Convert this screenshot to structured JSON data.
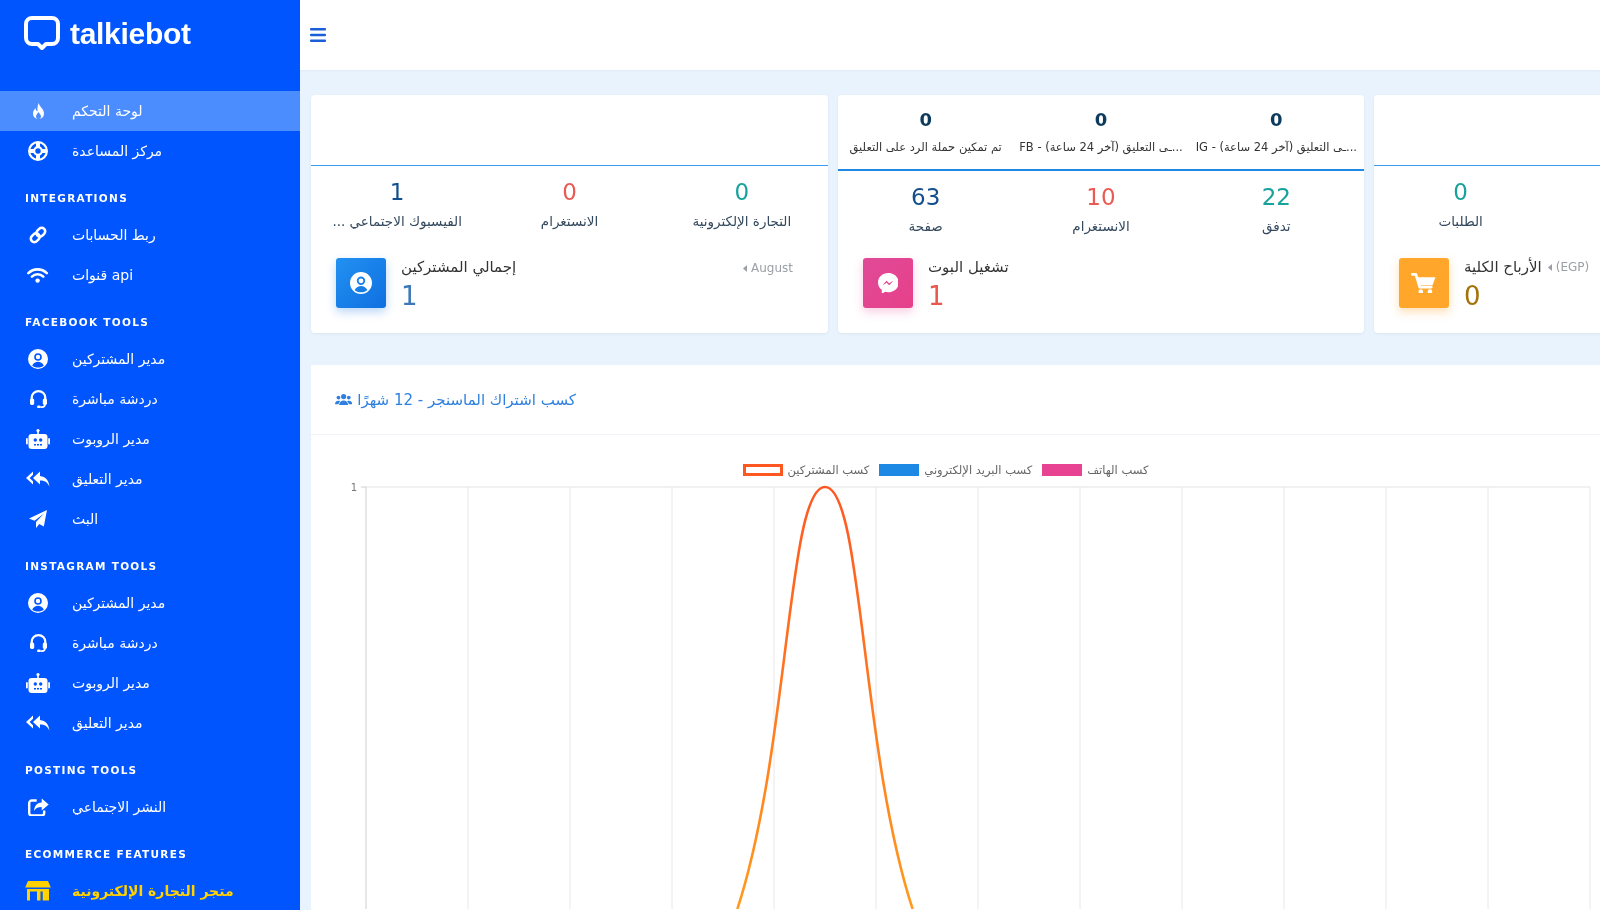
{
  "sidebar": {
    "logo_text": "talkiebot",
    "sections": [
      {
        "items": [
          {
            "label": "لوحة التحكم",
            "selected": true,
            "highlighted": false
          },
          {
            "label": "مركز المساعدة",
            "selected": false,
            "highlighted": false
          }
        ]
      },
      {
        "heading": "INTEGRATIONS",
        "items": [
          {
            "label": "ربط الحسابات",
            "selected": false,
            "highlighted": false
          },
          {
            "label": "قنوات api",
            "selected": false,
            "highlighted": false
          }
        ]
      },
      {
        "heading": "FACEBOOK TOOLS",
        "items": [
          {
            "label": "مدير المشتركين",
            "selected": false,
            "highlighted": false
          },
          {
            "label": "دردشة مباشرة",
            "selected": false,
            "highlighted": false
          },
          {
            "label": "مدير الروبوت",
            "selected": false,
            "highlighted": false
          },
          {
            "label": "مدير التعليق",
            "selected": false,
            "highlighted": false
          },
          {
            "label": "البث",
            "selected": false,
            "highlighted": false
          }
        ]
      },
      {
        "heading": "INSTAGRAM TOOLS",
        "items": [
          {
            "label": "مدير المشتركين",
            "selected": false,
            "highlighted": false
          },
          {
            "label": "دردشة مباشرة",
            "selected": false,
            "highlighted": false
          },
          {
            "label": "مدير الروبوت",
            "selected": false,
            "highlighted": false
          },
          {
            "label": "مدير التعليق",
            "selected": false,
            "highlighted": false
          }
        ]
      },
      {
        "heading": "POSTING TOOLS",
        "items": [
          {
            "label": "النشر الاجتماعي",
            "selected": false,
            "highlighted": false
          }
        ]
      },
      {
        "heading": "ECOMMERCE FEATURES",
        "items": [
          {
            "label": "متجر التجارة الإلكترونية",
            "selected": false,
            "highlighted": true
          }
        ]
      }
    ]
  },
  "cards": [
    {
      "stats": [
        {
          "kind": "teal",
          "value": "0",
          "label": "الطلبات"
        }
      ],
      "summary": {
        "kind": "earnings",
        "title": "الأرباح الكلية",
        "value": "0",
        "dropdown": "(EGP)"
      }
    },
    {
      "header_stats": [
        {
          "value": "0",
          "label": "...ـى التعليق (آخر 24 ساعة) - IG"
        },
        {
          "value": "0",
          "label": "...ـى التعليق (آخر 24 ساعة) - FB"
        },
        {
          "value": "0",
          "label": "تم تمكين حملة الرد على التعليق"
        }
      ],
      "stats": [
        {
          "kind": "teal",
          "value": "22",
          "label": "تدفق"
        },
        {
          "kind": "instagram",
          "value": "10",
          "label": "الانستغرام"
        },
        {
          "kind": "navy",
          "value": "63",
          "label": "صفحة"
        }
      ],
      "summary": {
        "kind": "bot",
        "title": "تشغيل البوت",
        "value": "1"
      }
    },
    {
      "stats": [
        {
          "kind": "teal",
          "value": "0",
          "label": "التجارة الإلكترونية"
        },
        {
          "kind": "instagram",
          "value": "0",
          "label": "الانستغرام"
        },
        {
          "kind": "navy",
          "value": "1",
          "label": "الفيسبوك الاجتماعي ..."
        }
      ],
      "summary": {
        "kind": "subscribers",
        "title": "إجمالي المشتركين",
        "value": "1",
        "dropdown": "August"
      }
    }
  ],
  "chart_panel": {
    "title": "كسب اشتراك الماسنجر - 12 شهرًا",
    "legend": [
      {
        "label": "كسب الهاتف",
        "color": "#e84393",
        "filled": true
      },
      {
        "label": "كسب البريد الإلكتروني",
        "color": "#1e88e5",
        "filled": true
      },
      {
        "label": "كسب المشتركين",
        "color": "#ff5722",
        "filled": false
      }
    ],
    "y_tick": "1"
  }
}
